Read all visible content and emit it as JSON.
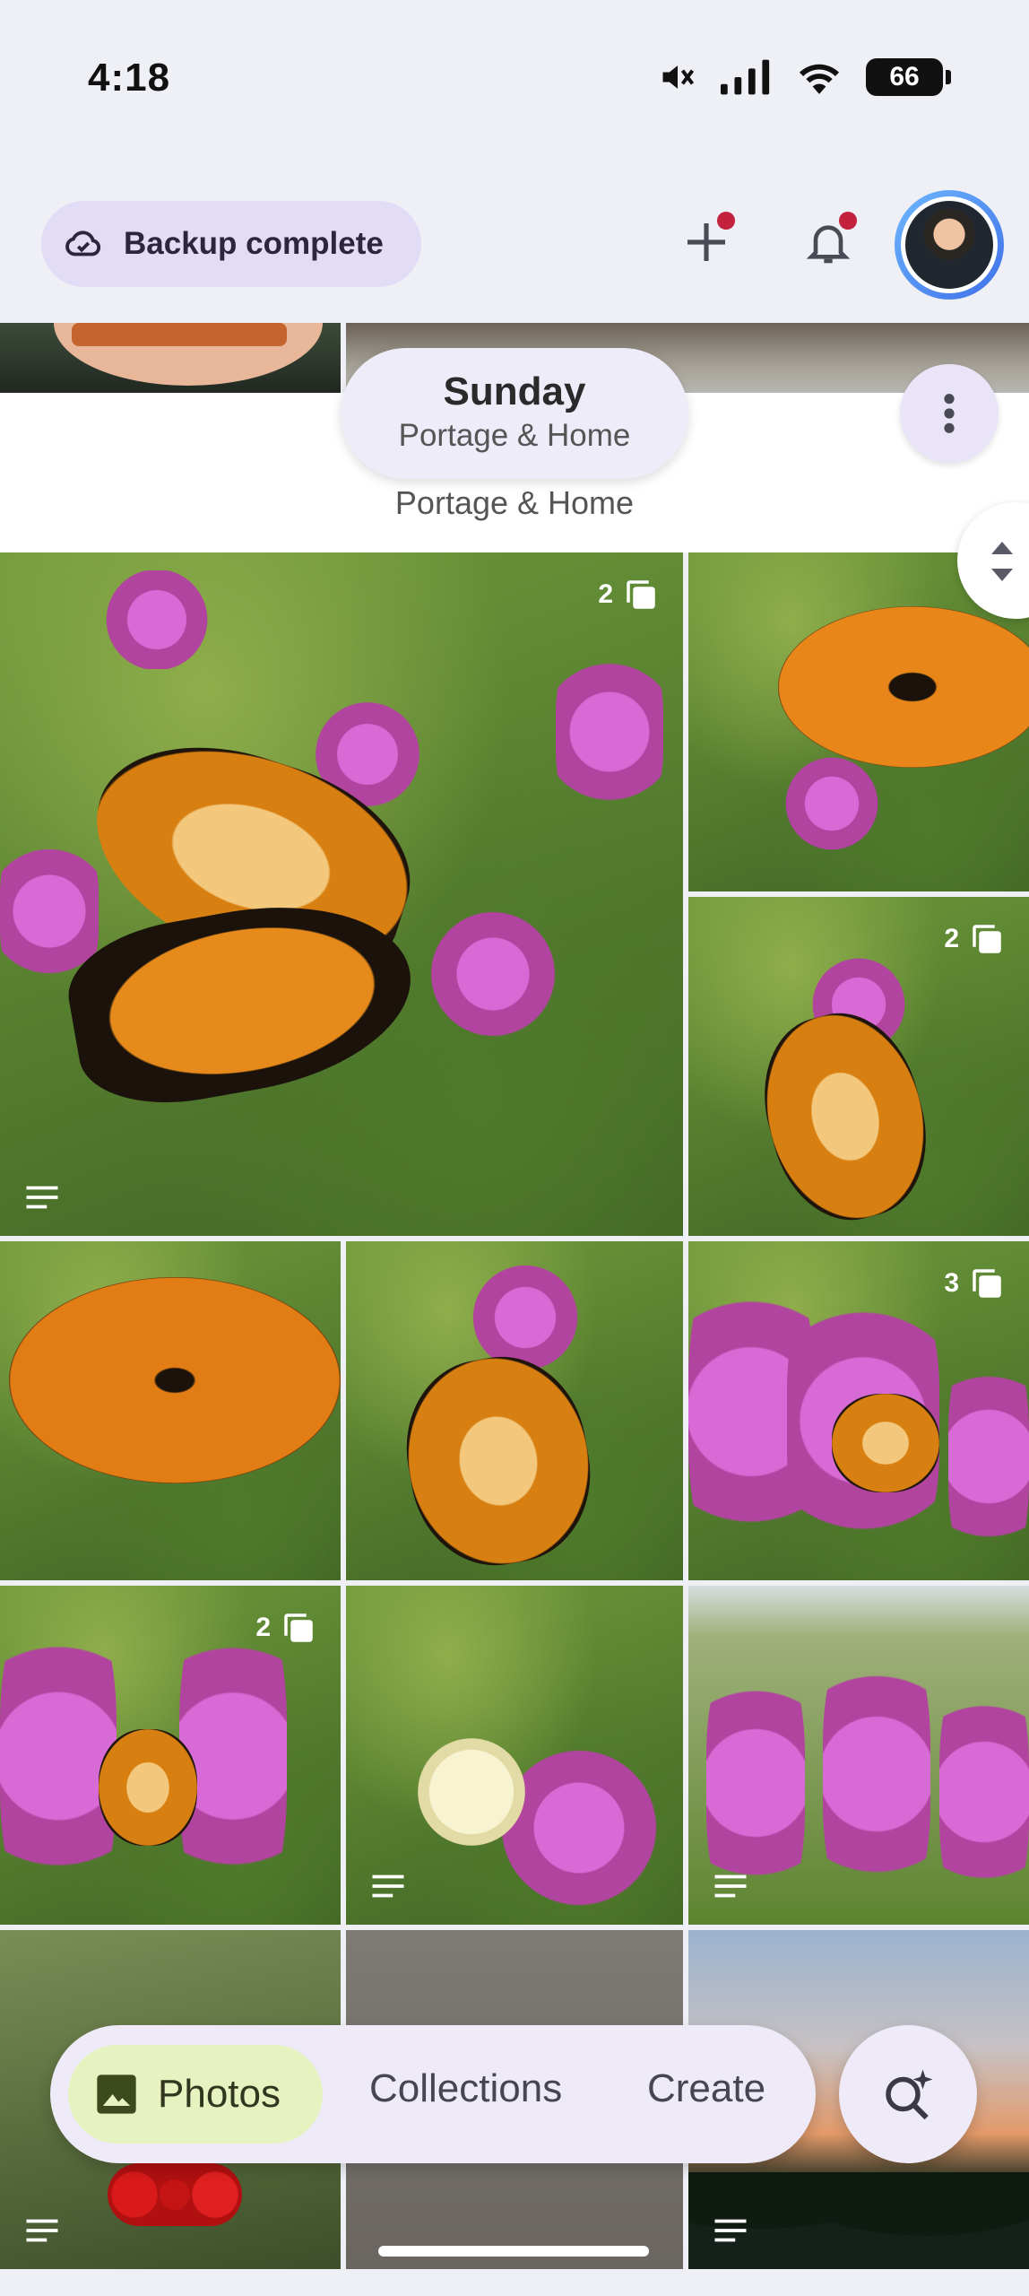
{
  "status_bar": {
    "time": "4:18",
    "battery": "66"
  },
  "top_bar": {
    "backup_label": "Backup complete"
  },
  "date_header": {
    "title": "Sunday",
    "subtitle": "Portage & Home",
    "location": "Portage & Home"
  },
  "tiles": {
    "t1_count": "2",
    "t3_count": "2",
    "t6_count": "3",
    "t7_count": "2"
  },
  "bottom_nav": {
    "photos_label": "Photos",
    "collections_label": "Collections",
    "create_label": "Create"
  },
  "icons": [
    "cloud-done-icon",
    "add-icon",
    "bell-icon",
    "more-vert-icon",
    "stack-icon",
    "caption-icon",
    "photos-icon",
    "search-sparkle-icon"
  ],
  "colors": {
    "accent_chip": "#e3dcf6",
    "photos_tab": "#e6f2c0",
    "notification_dot": "#c2223b"
  }
}
